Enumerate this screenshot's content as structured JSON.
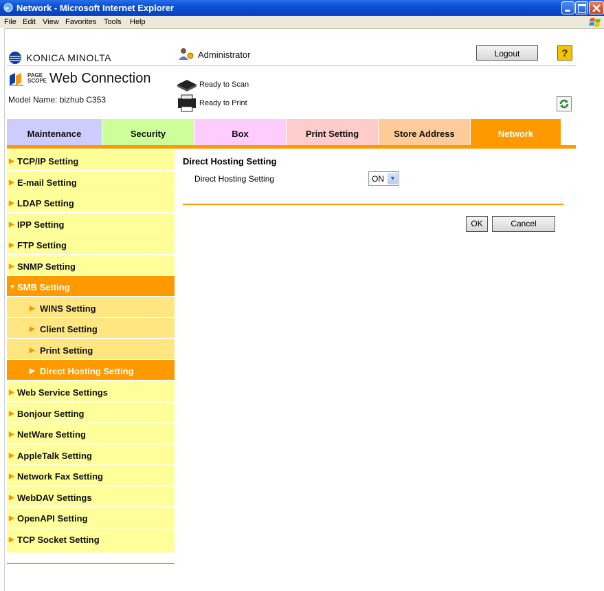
{
  "window": {
    "title": "Network - Microsoft Internet Explorer"
  },
  "menu": [
    "File",
    "Edit",
    "View",
    "Favorites",
    "Tools",
    "Help"
  ],
  "header": {
    "brand": "KONICA MINOLTA",
    "product_prefix": "PAGE SCOPE",
    "product": "Web Connection",
    "model": "Model Name: bizhub C353",
    "user": "Administrator",
    "scan_status": "Ready to Scan",
    "print_status": "Ready to Print",
    "logout_label": "Logout",
    "help_label": "?"
  },
  "tabs": [
    {
      "label": "Maintenance",
      "color": "#ccccff"
    },
    {
      "label": "Security",
      "color": "#ccff99"
    },
    {
      "label": "Box",
      "color": "#ffccff"
    },
    {
      "label": "Print Setting",
      "color": "#ffcccc"
    },
    {
      "label": "Store Address",
      "color": "#ffcc99"
    },
    {
      "label": "Network",
      "color": "#ff9900",
      "active": true
    }
  ],
  "sidebar": {
    "items": [
      "TCP/IP Setting",
      "E-mail Setting",
      "LDAP Setting",
      "IPP Setting",
      "FTP Setting",
      "SNMP Setting",
      "SMB Setting",
      "WINS Setting",
      "Client Setting",
      "Print Setting",
      "Direct Hosting Setting",
      "Web Service Settings",
      "Bonjour Setting",
      "NetWare Setting",
      "AppleTalk Setting",
      "Network Fax Setting",
      "WebDAV Settings",
      "OpenAPI Setting",
      "TCP Socket Setting"
    ]
  },
  "main": {
    "title": "Direct Hosting Setting",
    "field_label": "Direct Hosting Setting",
    "field_value": "ON",
    "ok_label": "OK",
    "cancel_label": "Cancel"
  }
}
